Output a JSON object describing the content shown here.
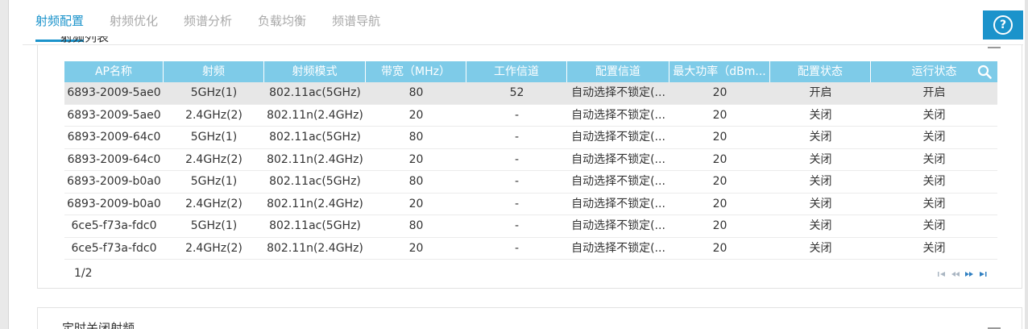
{
  "tabs": [
    {
      "label": "射频配置",
      "active": true
    },
    {
      "label": "射频优化",
      "active": false
    },
    {
      "label": "频谱分析",
      "active": false
    },
    {
      "label": "负载均衡",
      "active": false
    },
    {
      "label": "频谱导航",
      "active": false
    }
  ],
  "help": {
    "icon": "question-circle-icon",
    "label": "?"
  },
  "panel": {
    "title": "射频列表",
    "collapse_icon": "collapse-icon"
  },
  "table": {
    "columns": [
      "AP名称",
      "射频",
      "射频模式",
      "带宽（MHz）",
      "工作信道",
      "配置信道",
      "最大功率（dBm...",
      "配置状态",
      "运行状态"
    ],
    "rows": [
      [
        "6893-2009-5ae0",
        "5GHz(1)",
        "802.11ac(5GHz)",
        "80",
        "52",
        "自动选择不锁定(...",
        "20",
        "开启",
        "开启"
      ],
      [
        "6893-2009-5ae0",
        "2.4GHz(2)",
        "802.11n(2.4GHz)",
        "20",
        "-",
        "自动选择不锁定(...",
        "20",
        "关闭",
        "关闭"
      ],
      [
        "6893-2009-64c0",
        "5GHz(1)",
        "802.11ac(5GHz)",
        "80",
        "-",
        "自动选择不锁定(...",
        "20",
        "关闭",
        "关闭"
      ],
      [
        "6893-2009-64c0",
        "2.4GHz(2)",
        "802.11n(2.4GHz)",
        "20",
        "-",
        "自动选择不锁定(...",
        "20",
        "关闭",
        "关闭"
      ],
      [
        "6893-2009-b0a0",
        "5GHz(1)",
        "802.11ac(5GHz)",
        "80",
        "-",
        "自动选择不锁定(...",
        "20",
        "关闭",
        "关闭"
      ],
      [
        "6893-2009-b0a0",
        "2.4GHz(2)",
        "802.11n(2.4GHz)",
        "20",
        "-",
        "自动选择不锁定(...",
        "20",
        "关闭",
        "关闭"
      ],
      [
        "6ce5-f73a-fdc0",
        "5GHz(1)",
        "802.11ac(5GHz)",
        "80",
        "-",
        "自动选择不锁定(...",
        "20",
        "关闭",
        "关闭"
      ],
      [
        "6ce5-f73a-fdc0",
        "2.4GHz(2)",
        "802.11n(2.4GHz)",
        "20",
        "-",
        "自动选择不锁定(...",
        "20",
        "关闭",
        "关闭"
      ]
    ],
    "selected_row": 0,
    "search_icon": "search-icon"
  },
  "pager": {
    "page_label": "1/2",
    "icons": [
      "first-page-icon",
      "prev-page-icon",
      "next-page-icon",
      "last-page-icon"
    ]
  },
  "panel2": {
    "title": "定时关闭射频"
  },
  "colors": {
    "accent": "#1b93cb",
    "header_bg": "#7ecbe8",
    "selected_row": "#e7e7e7"
  }
}
